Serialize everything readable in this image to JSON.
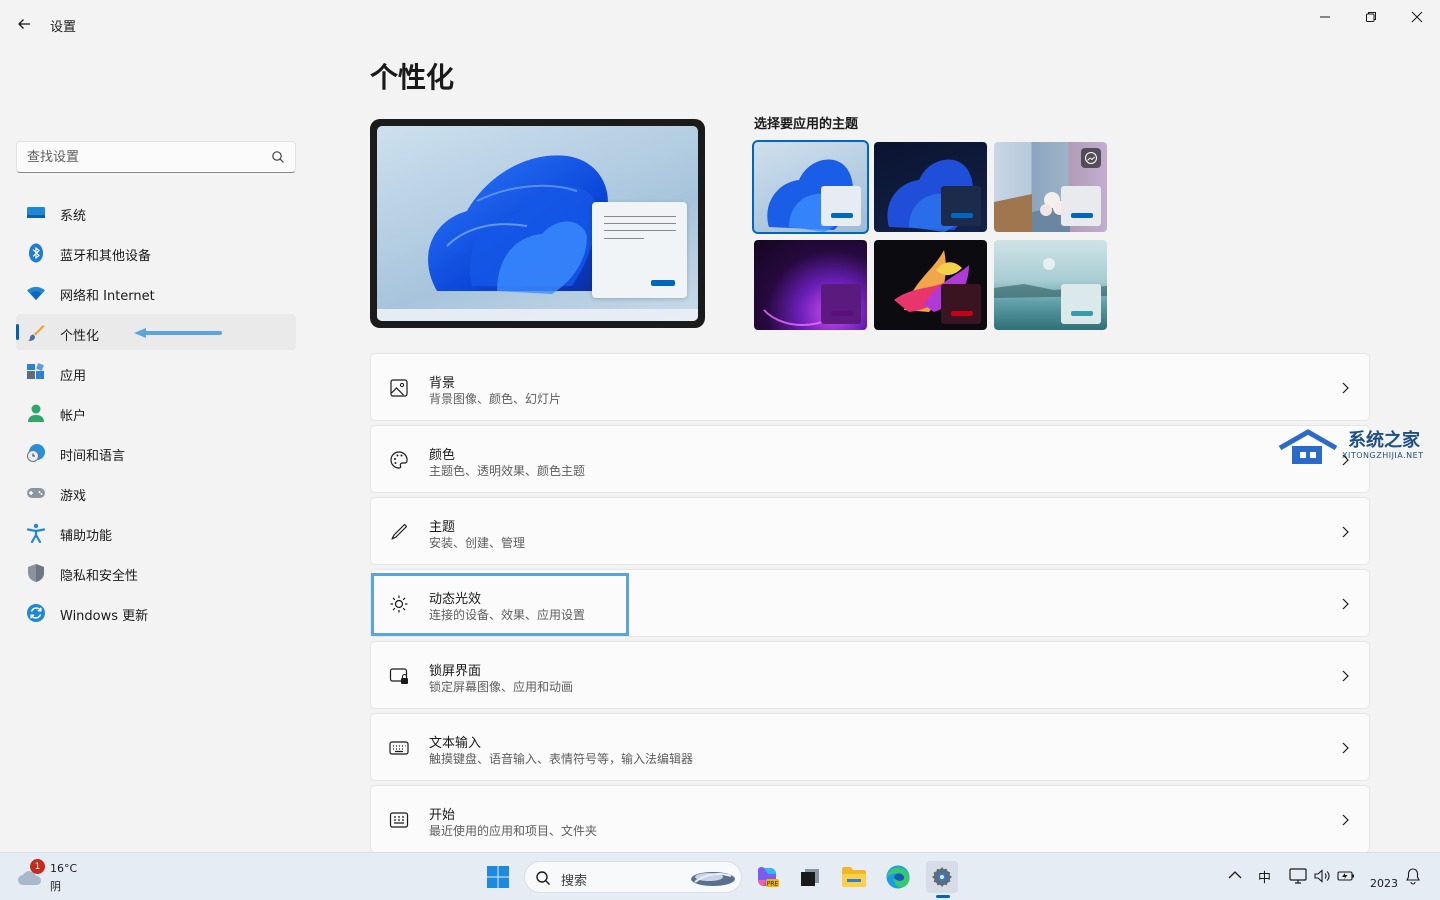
{
  "window": {
    "title": "设置"
  },
  "sidebar": {
    "search_placeholder": "查找设置",
    "items": [
      {
        "label": "系统",
        "icon": "monitor-icon"
      },
      {
        "label": "蓝牙和其他设备",
        "icon": "bluetooth-icon"
      },
      {
        "label": "网络和 Internet",
        "icon": "wifi-icon"
      },
      {
        "label": "个性化",
        "icon": "brush-icon",
        "active": true
      },
      {
        "label": "应用",
        "icon": "apps-icon"
      },
      {
        "label": "帐户",
        "icon": "person-icon"
      },
      {
        "label": "时间和语言",
        "icon": "globe-clock-icon"
      },
      {
        "label": "游戏",
        "icon": "gamepad-icon"
      },
      {
        "label": "辅助功能",
        "icon": "accessibility-icon"
      },
      {
        "label": "隐私和安全性",
        "icon": "shield-icon"
      },
      {
        "label": "Windows 更新",
        "icon": "update-icon"
      }
    ]
  },
  "main": {
    "page_title": "个性化",
    "themes_label": "选择要应用的主题",
    "themes": [
      {
        "selected": true,
        "accent": "#0067c0"
      },
      {
        "selected": false,
        "accent": "#0067c0"
      },
      {
        "selected": false,
        "accent": "#0067c0"
      },
      {
        "selected": false,
        "accent": "#5c0f7a"
      },
      {
        "selected": false,
        "accent": "#c4001a"
      },
      {
        "selected": false,
        "accent": "#3a9bb0"
      }
    ],
    "cards": [
      {
        "title": "背景",
        "subtitle": "背景图像、颜色、幻灯片",
        "icon": "image-icon"
      },
      {
        "title": "颜色",
        "subtitle": "主题色、透明效果、颜色主题",
        "icon": "palette-icon"
      },
      {
        "title": "主题",
        "subtitle": "安装、创建、管理",
        "icon": "pen-icon"
      },
      {
        "title": "动态光效",
        "subtitle": "连接的设备、效果、应用设置",
        "icon": "dynamic-lighting-icon",
        "highlighted": true
      },
      {
        "title": "锁屏界面",
        "subtitle": "锁定屏幕图像、应用和动画",
        "icon": "lock-screen-icon"
      },
      {
        "title": "文本输入",
        "subtitle": "触摸键盘、语音输入、表情符号等，输入法编辑器",
        "icon": "keyboard-icon"
      },
      {
        "title": "开始",
        "subtitle": "最近使用的应用和项目、文件夹",
        "icon": "start-icon"
      }
    ]
  },
  "watermark": {
    "name": "系统之家",
    "domain": "XITONGZHIJIA.NET"
  },
  "taskbar": {
    "weather_badge": "1",
    "weather_temp": "16°C",
    "weather_cond": "阴",
    "search_label": "搜索",
    "ime": "中",
    "clock": "2023"
  },
  "colors": {
    "accent": "#0067c0",
    "annotation": "#5aa6dc"
  }
}
